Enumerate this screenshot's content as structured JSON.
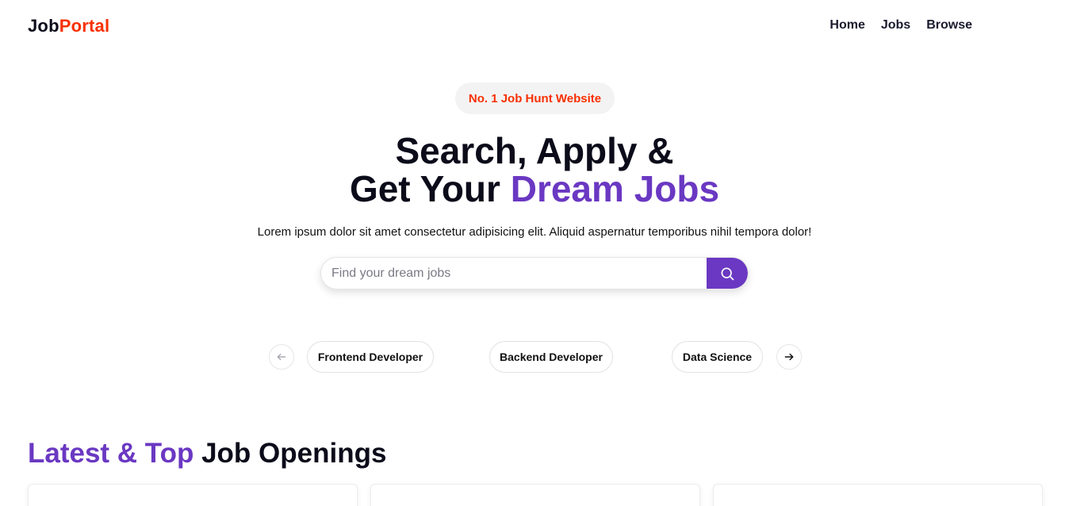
{
  "brand": {
    "part1": "Job",
    "part2": "Portal"
  },
  "nav": {
    "home": "Home",
    "jobs": "Jobs",
    "browse": "Browse"
  },
  "hero": {
    "badge": "No. 1 Job Hunt Website",
    "title_line1": "Search, Apply &",
    "title_line2_prefix": "Get Your ",
    "title_line2_accent": "Dream Jobs",
    "subtitle": "Lorem ipsum dolor sit amet consectetur adipisicing elit. Aliquid aspernatur temporibus nihil tempora dolor!"
  },
  "search": {
    "placeholder": "Find your dream jobs",
    "value": "",
    "icon": "search-icon"
  },
  "categories": {
    "prev_icon": "arrow-left-icon",
    "next_icon": "arrow-right-icon",
    "items": [
      "Frontend Developer",
      "Backend Developer",
      "Data Science"
    ]
  },
  "latest": {
    "title_accent": "Latest & Top",
    "title_rest": " Job Openings"
  },
  "colors": {
    "brand_red": "#f83002",
    "accent_purple": "#6a38c2",
    "text_dark": "#0b0b1a"
  }
}
